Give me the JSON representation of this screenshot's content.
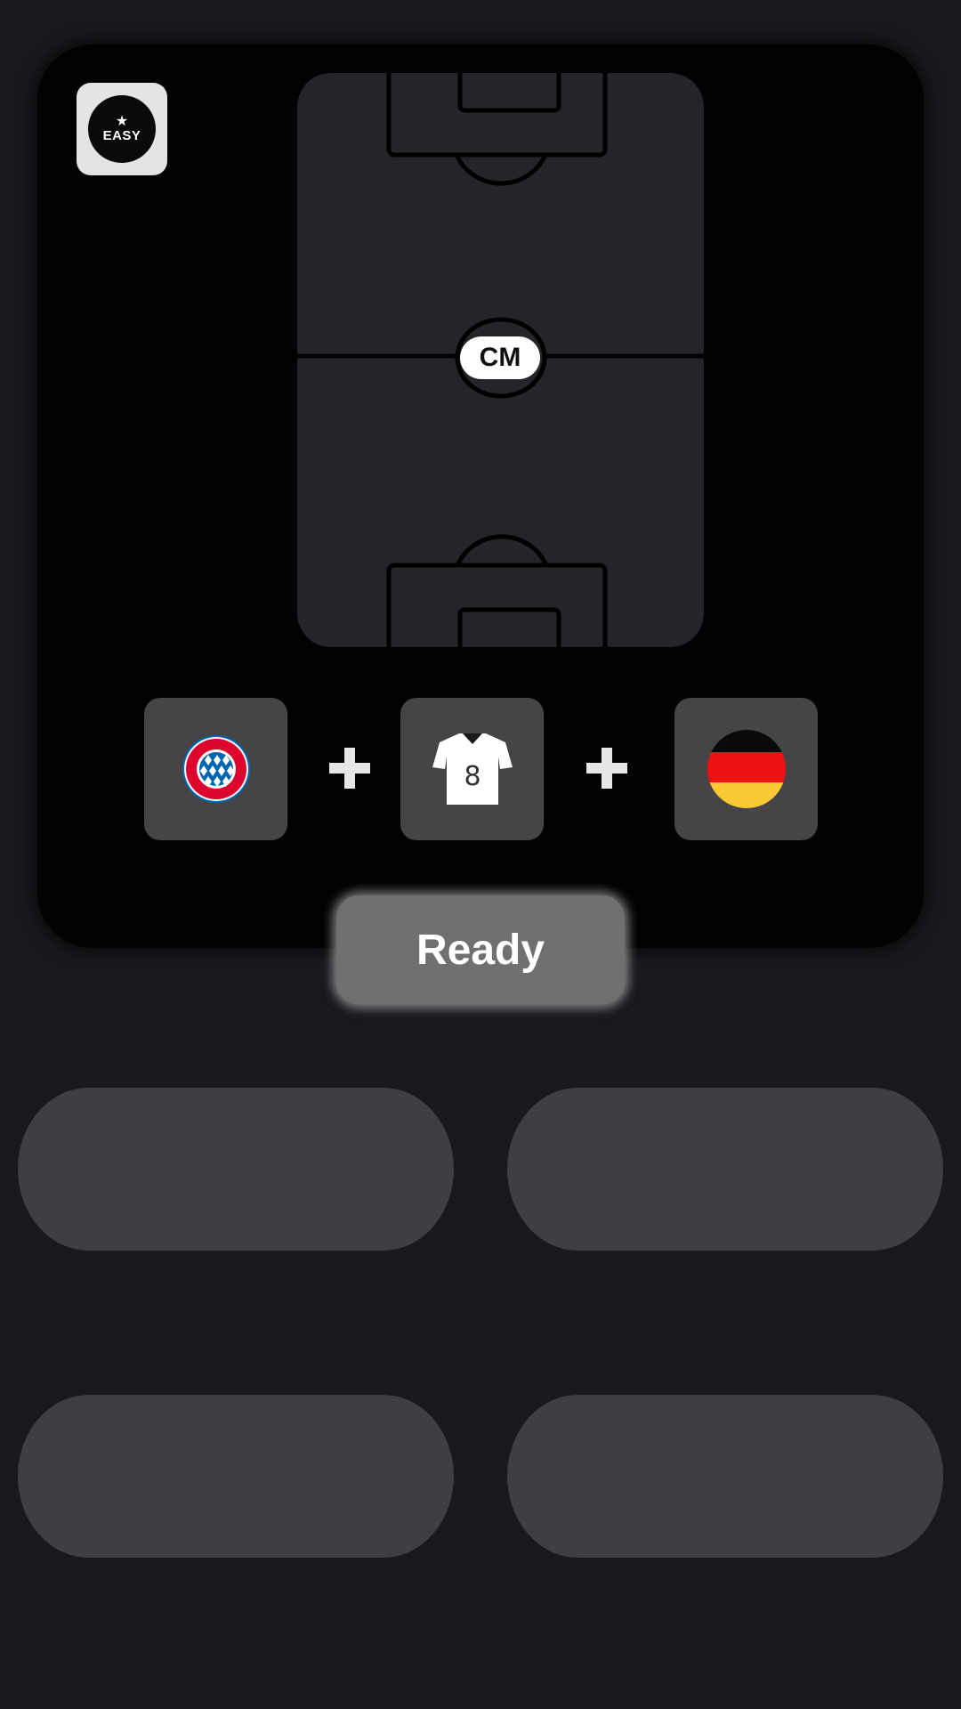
{
  "difficulty_badge": {
    "icon": "star-icon",
    "label": "EASY"
  },
  "pitch": {
    "position_label": "CM"
  },
  "clues": [
    {
      "type": "club",
      "name": "Bayern Munich",
      "icon": "bayern-crest-icon"
    },
    {
      "type": "shirt_number",
      "value": "8",
      "icon": "jersey-icon"
    },
    {
      "type": "nationality",
      "name": "Germany",
      "icon": "germany-flag-icon"
    }
  ],
  "plus_symbol": "+",
  "ready_button": {
    "label": "Ready"
  },
  "answer_options": [
    "",
    "",
    "",
    ""
  ],
  "colors": {
    "background": "#1a181c",
    "card": "#020103",
    "pitch": "#262428",
    "clue_tile": "#464446",
    "answer_slot": "#403e42",
    "ready_button": "#707071",
    "flag_black": "#0a0a0a",
    "flag_red": "#ee1111",
    "flag_gold": "#fcc936",
    "bayern_red": "#dc052d",
    "bayern_blue": "#0066b2"
  }
}
